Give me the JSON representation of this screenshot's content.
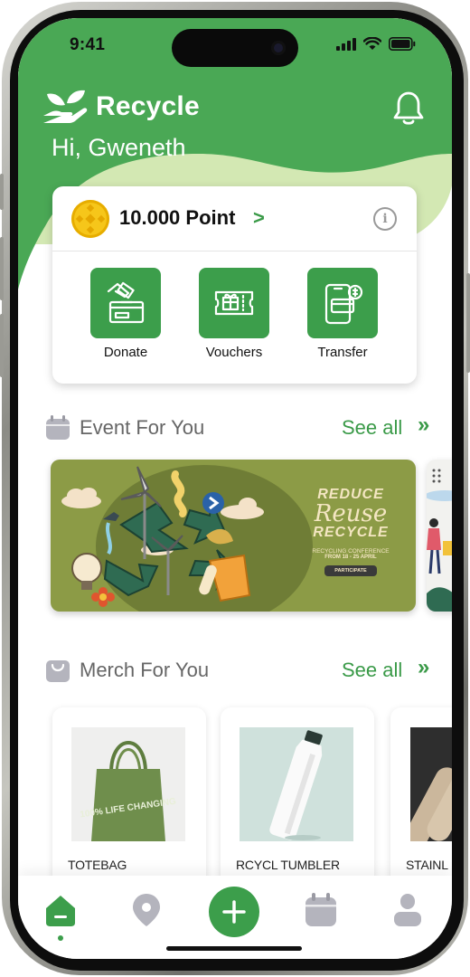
{
  "status_bar": {
    "time": "9:41"
  },
  "header": {
    "brand_name": "Recycle",
    "greeting": "Hi, Gweneth"
  },
  "points_card": {
    "points_label": "10.000 Point",
    "chevron": ">",
    "info_symbol": "i",
    "actions": [
      {
        "label": "Donate",
        "icon": "donate-hand-card-icon"
      },
      {
        "label": "Vouchers",
        "icon": "gift-voucher-icon"
      },
      {
        "label": "Transfer",
        "icon": "phone-transfer-icon"
      }
    ]
  },
  "events": {
    "title": "Event For You",
    "see_all": "See all",
    "see_all_chevron": "»",
    "banner": {
      "line1": "REDUCE",
      "line2": "Reuse",
      "line3": "RECYCLE",
      "conference": "RECYCLING CONFERENCE",
      "dates": "FROM 18 - 25 APRIL",
      "button": "PARTICIPATE"
    }
  },
  "merch": {
    "title": "Merch For You",
    "see_all": "See all",
    "see_all_chevron": "»",
    "items": [
      {
        "name": "TOTEBAG",
        "print": "100% LIFE CHANGING"
      },
      {
        "name": "RCYCL TUMBLER"
      },
      {
        "name": "STAINL"
      }
    ]
  },
  "tab_bar": {
    "tabs": [
      "home-icon",
      "location-pin-icon",
      "add-icon",
      "calendar-icon",
      "profile-icon"
    ],
    "active": "home"
  },
  "colors": {
    "primary": "#3c9e4b",
    "header_green": "#4aa855",
    "header_light": "#d3e8b3",
    "banner_olive": "#8c9b46",
    "coin": "#f6c61a"
  }
}
